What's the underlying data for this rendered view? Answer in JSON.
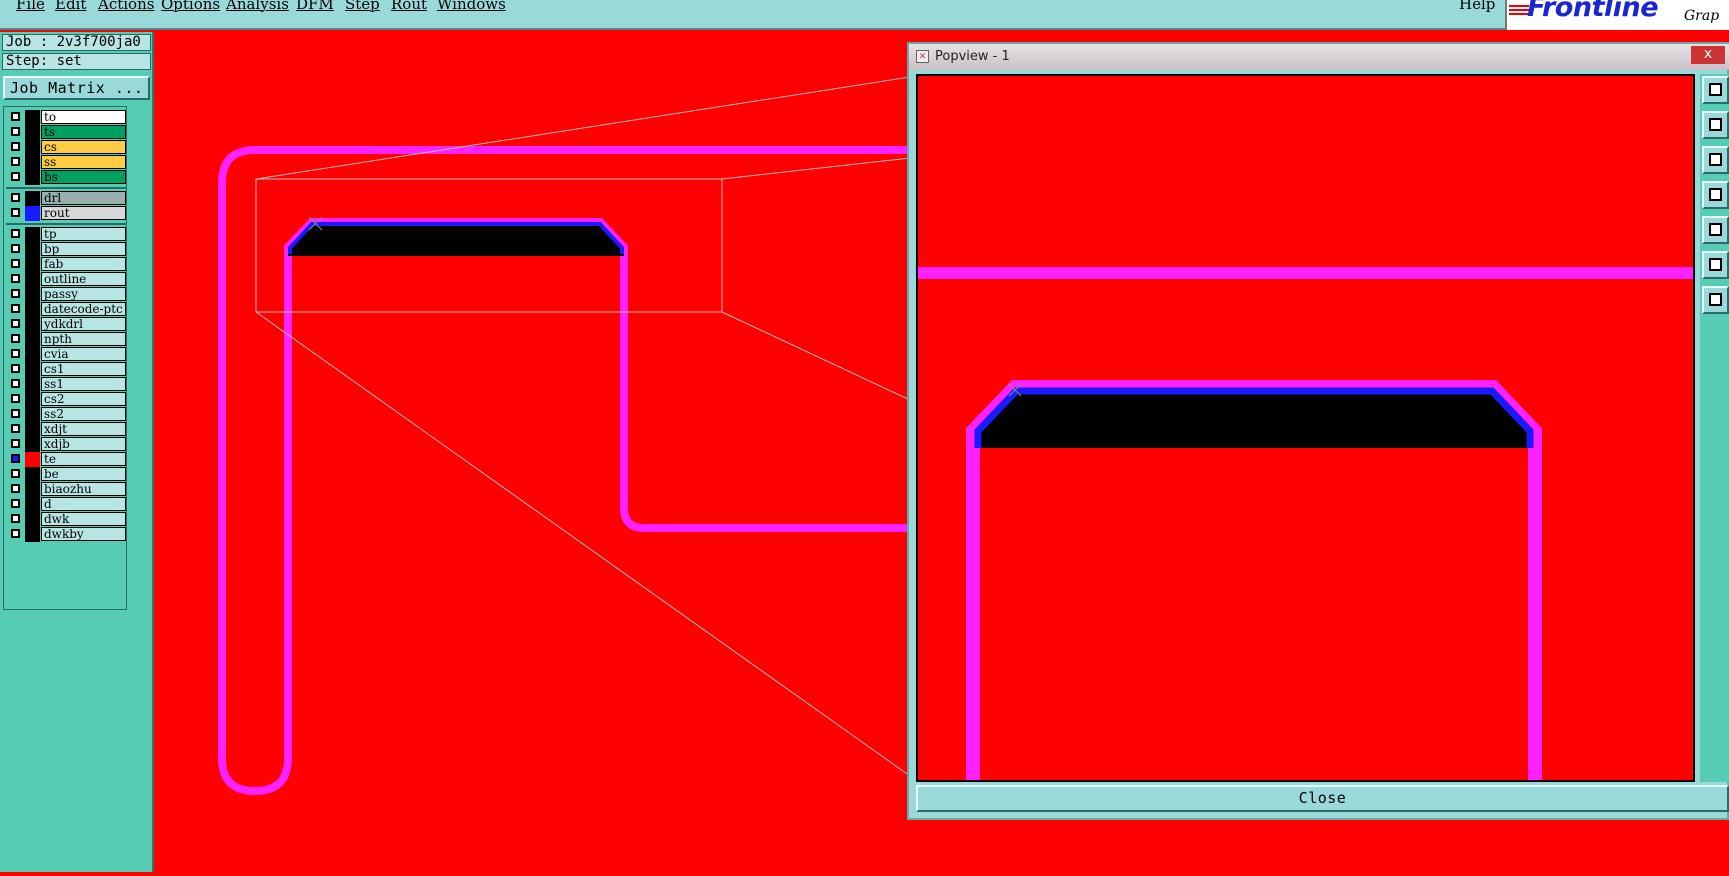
{
  "menubar": {
    "items": [
      "File",
      "Edit",
      "Actions",
      "Options",
      "Analysis",
      "DFM",
      "Step",
      "Rout",
      "Windows"
    ],
    "help": "Help"
  },
  "logo": {
    "text": "Frontline",
    "sub": "Grap"
  },
  "job": {
    "job_label": "Job : 2v3f700ja0",
    "step_label": "Step: set",
    "job_matrix_button": "Job Matrix ..."
  },
  "layers": {
    "group1": [
      {
        "name": "to",
        "color": "#ffffff"
      },
      {
        "name": "ts",
        "color": "#00a060"
      },
      {
        "name": "cs",
        "color": "#ffcc44"
      },
      {
        "name": "ss",
        "color": "#ffcc44"
      },
      {
        "name": "bs",
        "color": "#00a060"
      }
    ],
    "group2": [
      {
        "name": "drl",
        "color": "#9ab0b0"
      },
      {
        "name": "rout",
        "color": "#d8d8d8"
      }
    ],
    "group3": [
      {
        "name": "tp"
      },
      {
        "name": "bp"
      },
      {
        "name": "fab"
      },
      {
        "name": "outline"
      },
      {
        "name": "passy"
      },
      {
        "name": "datecode-ptc"
      },
      {
        "name": "ydkdrl"
      },
      {
        "name": "npth"
      },
      {
        "name": "cvia"
      },
      {
        "name": "cs1"
      },
      {
        "name": "ss1"
      },
      {
        "name": "cs2"
      },
      {
        "name": "ss2"
      },
      {
        "name": "xdjt"
      },
      {
        "name": "xdjb"
      },
      {
        "name": "te"
      },
      {
        "name": "be"
      },
      {
        "name": "biaozhu"
      },
      {
        "name": "d"
      },
      {
        "name": "dwk"
      },
      {
        "name": "dwkby"
      }
    ]
  },
  "popup": {
    "title": "Popview - 1",
    "close_label": "Close",
    "close_x": "x"
  },
  "colors": {
    "background": "#ff0000",
    "trace": "#ff22ff",
    "edge": "#1a1aff",
    "fill": "#000000",
    "panel": "#56cdb3",
    "menu": "#9ad9d9"
  }
}
